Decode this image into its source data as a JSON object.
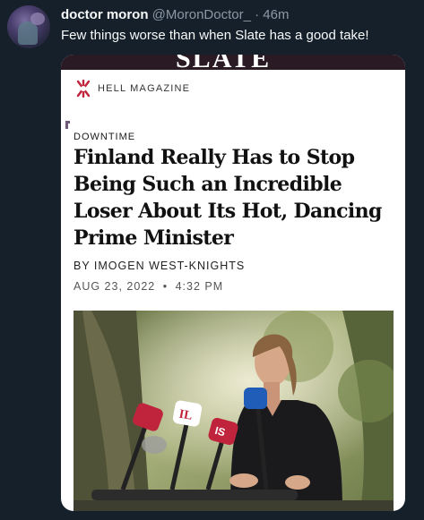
{
  "tweet": {
    "display_name": "doctor moron",
    "handle": "@MoronDoctor_",
    "separator": "·",
    "time": "46m",
    "text": "Few things worse than when Slate has a good take!"
  },
  "card": {
    "site_logo": "SLATE",
    "section_icon": "slate-star-icon",
    "section": "HELL MAGAZINE",
    "kicker": "DOWNTIME",
    "headline": "Finland Really Has to Stop Being Such an Incredible Loser About Its Hot, Dancing Prime Minister",
    "byline": "BY IMOGEN WEST-KNIGHTS",
    "date": "AUG 23, 2022",
    "date_separator": "•",
    "time": "4:32 PM",
    "photo": {
      "description": "prime-minister-at-press-microphones",
      "mic_labels": [
        "IL",
        "IS"
      ]
    }
  },
  "colors": {
    "background": "#15202b",
    "text_primary": "#f7f9f9",
    "text_secondary": "#8b98a5",
    "slate_accent": "#c0243c"
  }
}
